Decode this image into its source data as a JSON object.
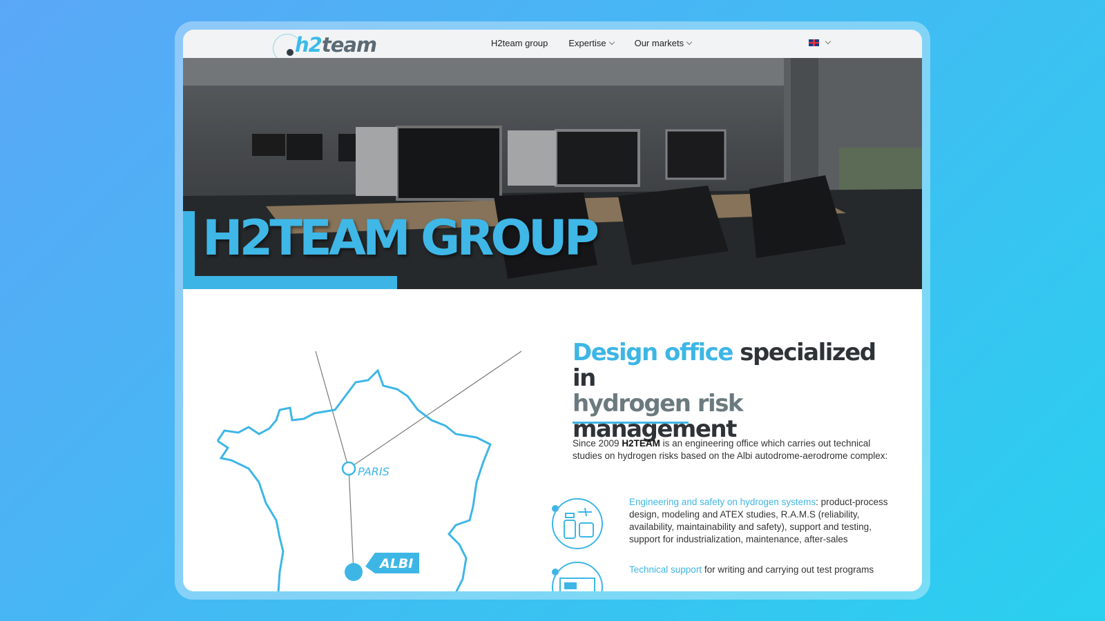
{
  "header": {
    "logo": {
      "part1": "h2",
      "part2": "team"
    },
    "nav": [
      {
        "label": "H2team group",
        "has_dropdown": false
      },
      {
        "label": "Expertise",
        "has_dropdown": true
      },
      {
        "label": "Our markets",
        "has_dropdown": true
      }
    ],
    "language": {
      "flag": "uk-flag-icon",
      "has_dropdown": true
    }
  },
  "hero": {
    "title": "H2TEAM GROUP"
  },
  "map": {
    "cities": {
      "paris": "PARIS",
      "albi": "ALBI"
    }
  },
  "main": {
    "headline": {
      "part_blue": "Design office",
      "part_dark": "specialized in",
      "part_grey": "hydrogen risk",
      "part_dark2": "management"
    },
    "intro": {
      "prefix": "Since 2009 ",
      "brand": "H2TEAM",
      "suffix": " is an engineering office which carries out technical studies on hydrogen risks based on the Albi autodrome-aerodrome complex:"
    },
    "services": [
      {
        "link": "Engineering and safety on hydrogen systems",
        "text": ": product-process design, modeling and ATEX studies, R.A.M.S (reliability, availability, maintainability and safety), support and testing, support for industrialization, maintenance, after-sales",
        "icon": "transport-vehicles-icon"
      },
      {
        "link": "Technical support",
        "text": " for writing and carrying out test programs",
        "icon": "truck-map-icon"
      }
    ]
  },
  "colors": {
    "accent": "#3db6e6",
    "dark": "#2e3338",
    "grey": "#6b7a7f"
  }
}
